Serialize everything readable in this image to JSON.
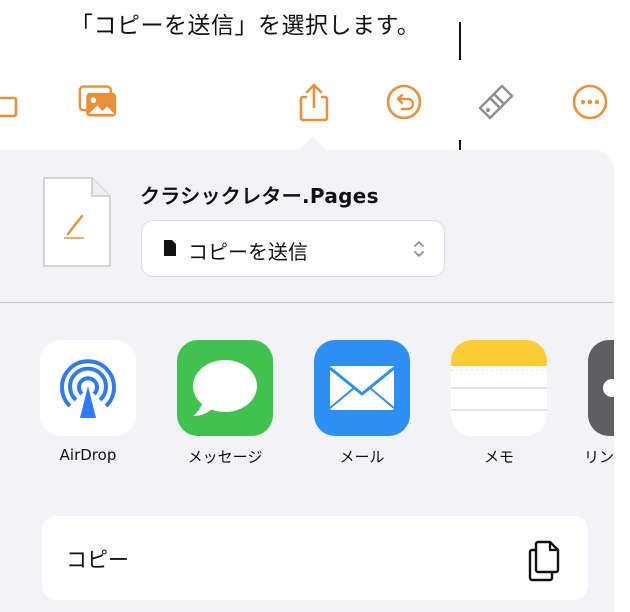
{
  "callout": {
    "text": "「コピーを送信」を選択します。"
  },
  "toolbar": {
    "icons": [
      "folder-icon",
      "media-icon",
      "share-icon",
      "undo-icon",
      "format-brush-icon",
      "more-icon"
    ],
    "accent": "#e8913a"
  },
  "share_sheet": {
    "document_name": "クラシックレター.Pages",
    "send_menu": {
      "selected": "コピーを送信"
    },
    "apps": [
      {
        "label": "AirDrop",
        "icon": "airdrop-icon"
      },
      {
        "label": "メッセージ",
        "icon": "messages-icon"
      },
      {
        "label": "メール",
        "icon": "mail-icon"
      },
      {
        "label": "メモ",
        "icon": "notes-icon"
      },
      {
        "label": "リン",
        "icon": "reminders-icon"
      }
    ],
    "actions": [
      {
        "label": "コピー",
        "icon": "copy-icon"
      }
    ]
  }
}
